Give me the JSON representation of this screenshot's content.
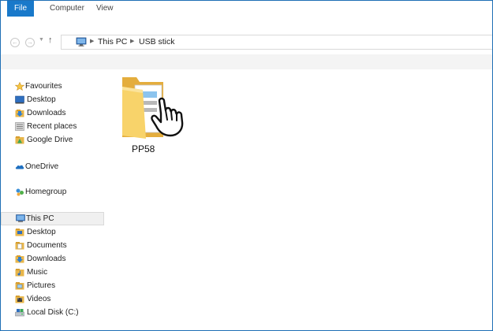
{
  "ribbon": {
    "tabs": [
      {
        "label": "File"
      },
      {
        "label": "Computer"
      },
      {
        "label": "View"
      }
    ]
  },
  "address": {
    "crumbs": [
      "This PC",
      "USB stick"
    ]
  },
  "sidebar": {
    "groups": {
      "favourites": {
        "label": "Favourites",
        "items": [
          {
            "label": "Desktop",
            "icon": "desktop-icon"
          },
          {
            "label": "Downloads",
            "icon": "downloads-icon"
          },
          {
            "label": "Recent places",
            "icon": "recent-places-icon"
          },
          {
            "label": "Google Drive",
            "icon": "google-drive-icon"
          }
        ]
      },
      "onedrive": {
        "label": "OneDrive"
      },
      "homegroup": {
        "label": "Homegroup"
      },
      "thispc": {
        "label": "This PC",
        "items": [
          {
            "label": "Desktop",
            "icon": "desktop-folder-icon"
          },
          {
            "label": "Documents",
            "icon": "documents-icon"
          },
          {
            "label": "Downloads",
            "icon": "downloads-icon"
          },
          {
            "label": "Music",
            "icon": "music-icon"
          },
          {
            "label": "Pictures",
            "icon": "pictures-icon"
          },
          {
            "label": "Videos",
            "icon": "videos-icon"
          },
          {
            "label": "Local Disk (C:)",
            "icon": "local-disk-icon"
          }
        ]
      }
    }
  },
  "content": {
    "items": [
      {
        "name": "PP58",
        "icon": "folder-icon"
      }
    ]
  },
  "colors": {
    "accent": "#1979ca",
    "folder": "#f5c94b",
    "selection": "#f0f0f0"
  }
}
